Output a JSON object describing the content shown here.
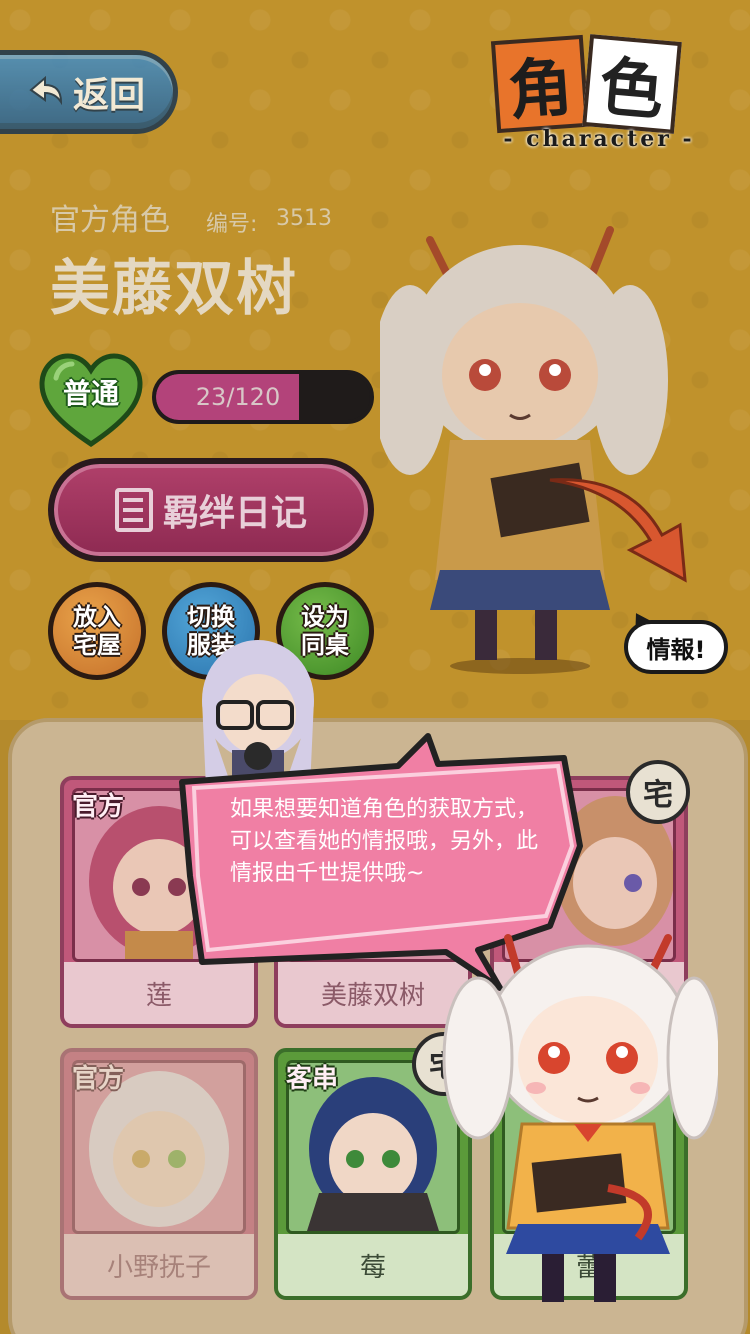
{
  "header": {
    "back_label": "返回",
    "logo_char1": "角",
    "logo_char2": "色",
    "logo_sub": "- character -"
  },
  "profile": {
    "type": "官方角色",
    "id_label": "编号:",
    "id": "3513",
    "name": "美藤双树"
  },
  "affection": {
    "level": "普通",
    "progress_text": "23/120",
    "progress_fraction": 0.19
  },
  "buttons": {
    "diary": "羁绊日记",
    "place_home": "放入宅屋",
    "switch_outfit": "切换服装",
    "set_deskmate": "设为同桌"
  },
  "info_bubble": "情報!",
  "tutorial": {
    "text": "如果想要知道角色的获取方式，可以查看她的情报哦，另外，此情报由千世提供哦~"
  },
  "cards": [
    {
      "tag": "官方",
      "name": "莲",
      "theme": "pink"
    },
    {
      "tag": "",
      "name": "美藤双树",
      "theme": "pink",
      "badge": "宅"
    },
    {
      "tag": "",
      "name": "",
      "theme": "pink"
    },
    {
      "tag": "官方",
      "name": "小野抚子",
      "theme": "pink-faded"
    },
    {
      "tag": "客串",
      "name": "莓",
      "theme": "green",
      "badge": "宅"
    },
    {
      "tag": "",
      "name": "蕾",
      "theme": "green"
    }
  ],
  "colors": {
    "background": "#c0922c",
    "pink_card": "#c0587a",
    "green_card": "#5b9a3a",
    "bubble_pink": "#f07fa4"
  }
}
